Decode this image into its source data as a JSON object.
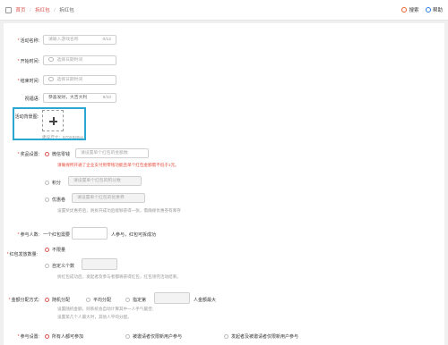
{
  "breadcrumb": {
    "home": "首页",
    "level2": "拆红包",
    "current": "拆红包"
  },
  "toolbar": {
    "search": "搜索",
    "help": "帮助"
  },
  "form": {
    "name": {
      "label": "活动名称:",
      "placeholder": "请输入游戏名称",
      "count": "0/12"
    },
    "start": {
      "label": "开始时间:",
      "placeholder": "选择日期时间"
    },
    "end": {
      "label": "结束时间:",
      "placeholder": "选择日期时间"
    },
    "share": {
      "label": "祝福语:",
      "value": "恭喜发财，大吉大利",
      "count": "9/10"
    },
    "bg": {
      "label": "活动背景图:",
      "hint": "建议尺寸：570X920px"
    },
    "prize": {
      "label": "奖品设置:",
      "wechat": "微信零钱",
      "wechat_placeholder": "请设置单个红包的金额数",
      "wechat_warn": "请确保所开通了企业支付到零钱功能且单个红包金额需不低于1元。",
      "points": "积分",
      "points_placeholder": "请设置单个红包的积分数",
      "coupon": "优惠卷",
      "coupon_placeholder": "请设置单个红包的优惠券",
      "coupon_hint": "设置奖优惠券后，则拆开成功后能够获得一张，需确保优惠券有库存"
    },
    "people": {
      "label": "参与人数:",
      "prefix": "一个红包需要",
      "suffix": "人参与，红包可拆成功"
    },
    "count": {
      "label": "红包发放数量:",
      "unlimited": "不限量",
      "custom": "自定义个数",
      "hint": "拆红包成功后，发起者及参与者都将获得红包，红包领完活动结束。"
    },
    "split": {
      "label": "金额分配方式:",
      "random": "随机分配",
      "average": "平均分配",
      "fixed": "指定第",
      "fixed_suffix": "人金额最大",
      "hint1": "设置随机金额，则系统会自动计算其中一人手气最佳;",
      "hint2": "设置第几个人最大时，其他人平均分配。"
    },
    "join": {
      "label": "参与设置:",
      "all": "所有人都可参加",
      "new": "被邀请者仅限新用户参与",
      "both": "发起者及被邀请者仅限新用户参与"
    }
  }
}
